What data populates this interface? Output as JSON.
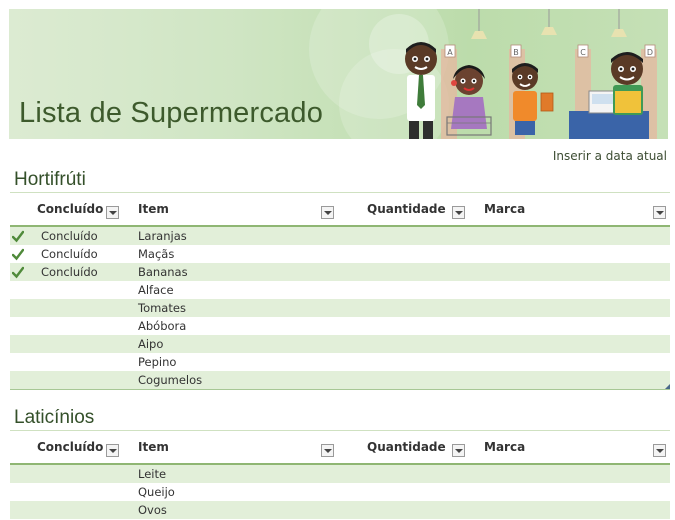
{
  "banner": {
    "title": "Lista de Supermercado",
    "aisle_signs": [
      "A",
      "B",
      "C",
      "D"
    ]
  },
  "date_link": "Inserir a data atual",
  "columns": {
    "done": "Concluído",
    "item": "Item",
    "quantity": "Quantidade",
    "brand": "Marca"
  },
  "sections": [
    {
      "title": "Hortifrúti",
      "rows": [
        {
          "done": "Concluído",
          "item": "Laranjas",
          "checked": true
        },
        {
          "done": "Concluído",
          "item": "Maçãs",
          "checked": true
        },
        {
          "done": "Concluído",
          "item": "Bananas",
          "checked": true
        },
        {
          "done": "",
          "item": "Alface",
          "checked": false
        },
        {
          "done": "",
          "item": "Tomates",
          "checked": false
        },
        {
          "done": "",
          "item": "Abóbora",
          "checked": false
        },
        {
          "done": "",
          "item": "Aipo",
          "checked": false
        },
        {
          "done": "",
          "item": "Pepino",
          "checked": false
        },
        {
          "done": "",
          "item": "Cogumelos",
          "checked": false
        }
      ]
    },
    {
      "title": "Laticínios",
      "rows": [
        {
          "done": "",
          "item": "Leite",
          "checked": false
        },
        {
          "done": "",
          "item": "Queijo",
          "checked": false
        },
        {
          "done": "",
          "item": "Ovos",
          "checked": false
        }
      ]
    }
  ],
  "colors": {
    "accent_green": "#8fb673",
    "band_green": "#e2efd9",
    "title_green": "#34502a",
    "check_green": "#4f8a3a"
  }
}
